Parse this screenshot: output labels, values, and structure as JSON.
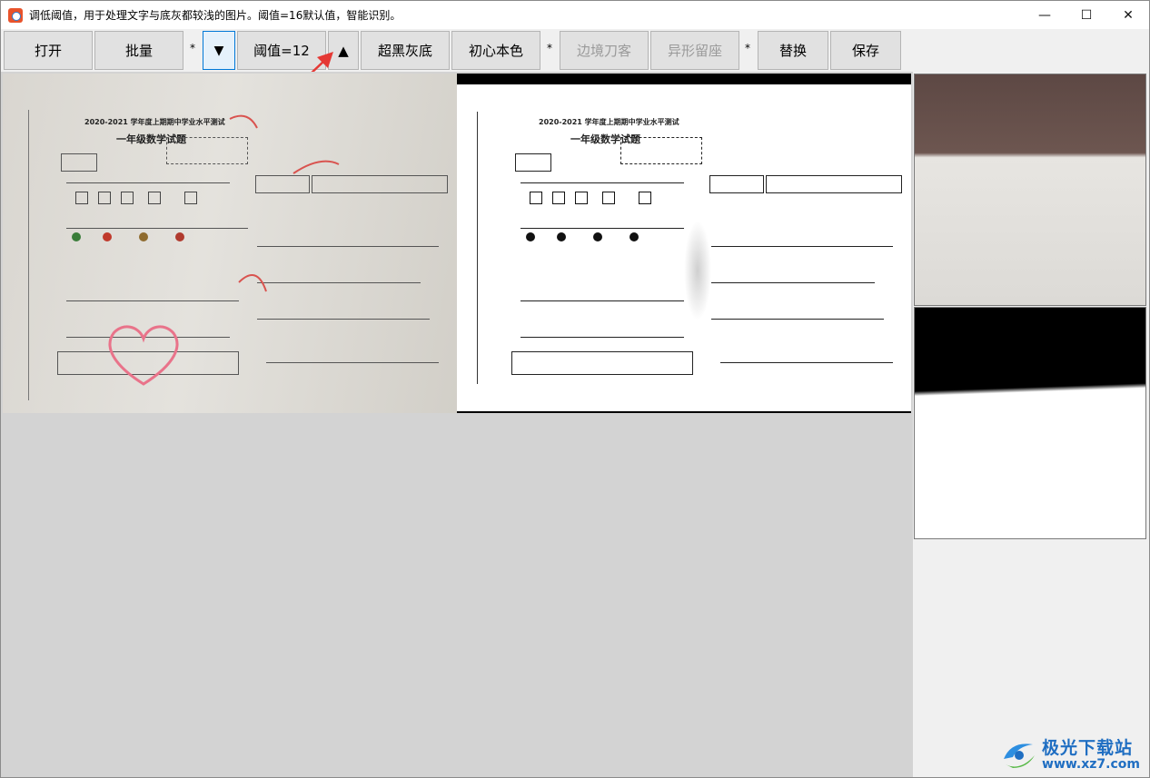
{
  "window": {
    "title": "调低阈值，用于处理文字与底灰都较浅的图片。阈值=16默认值，智能识别。",
    "minimize_glyph": "—",
    "maximize_glyph": "☐",
    "close_glyph": "✕"
  },
  "toolbar": {
    "open_label": "打开",
    "batch_label": "批量",
    "sep1": "*",
    "threshold_down_glyph": "▼",
    "threshold_label": "阈值=12",
    "threshold_up_glyph": "▲",
    "super_black_gray_label": "超黑灰底",
    "original_color_label": "初心本色",
    "sep2": "*",
    "border_cut_label": "边境刀客",
    "shape_keep_label": "异形留座",
    "sep3": "*",
    "replace_label": "替换",
    "save_label": "保存"
  },
  "document": {
    "title": "2020-2021 学年度上期期中学业水平测试",
    "subtitle": "一年级数学试题"
  },
  "colors": {
    "annotation_arrow": "#e53935",
    "toolbar_button": "#e1e1e1",
    "highlight_border": "#0078d7",
    "workarea": "#d3d3d3"
  },
  "watermark": {
    "name": "极光下载站",
    "url": "www.xz7.com"
  }
}
